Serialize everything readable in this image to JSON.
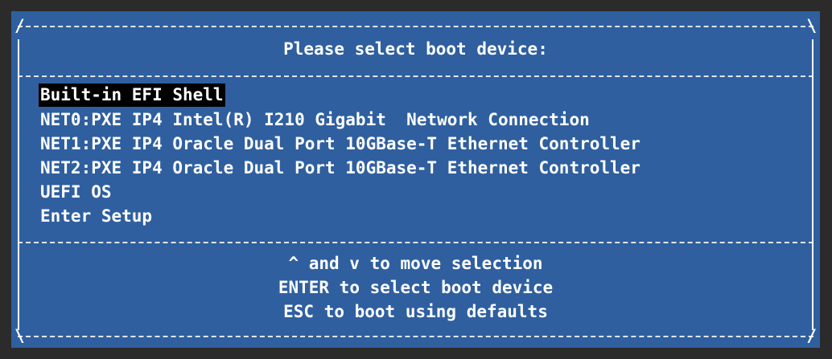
{
  "header": {
    "title": "Please select boot device:"
  },
  "menu": {
    "items": [
      {
        "label": "Built-in EFI Shell",
        "selected": true
      },
      {
        "label": "NET0:PXE IP4 Intel(R) I210 Gigabit  Network Connection",
        "selected": false
      },
      {
        "label": "NET1:PXE IP4 Oracle Dual Port 10GBase-T Ethernet Controller",
        "selected": false
      },
      {
        "label": "NET2:PXE IP4 Oracle Dual Port 10GBase-T Ethernet Controller",
        "selected": false
      },
      {
        "label": "UEFI OS",
        "selected": false
      },
      {
        "label": "Enter Setup",
        "selected": false
      }
    ]
  },
  "help": {
    "line1": "^ and v to move selection",
    "line2": "ENTER to select boot device",
    "line3": "ESC to boot using defaults"
  },
  "colors": {
    "background": "#2f5f9f",
    "highlight": "#000000",
    "text": "#ffffff"
  }
}
